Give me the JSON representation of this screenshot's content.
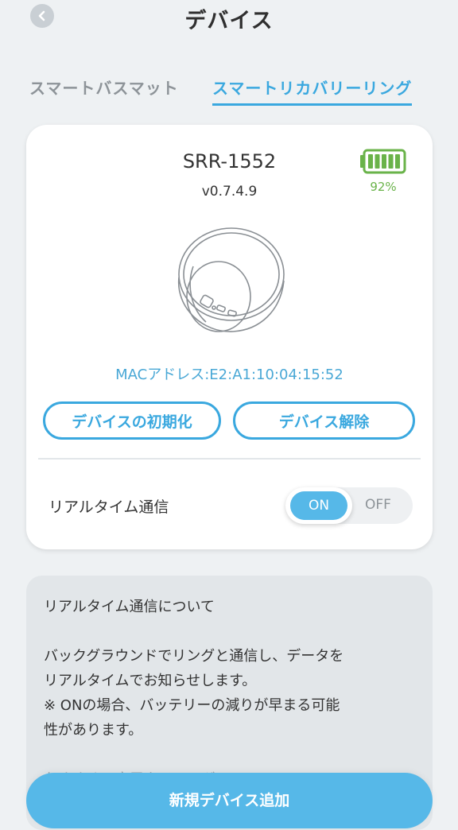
{
  "header": {
    "title": "デバイス"
  },
  "tabs": [
    {
      "label": "スマートバスマット",
      "active": false
    },
    {
      "label": "スマートリカバリーリング",
      "active": true
    }
  ],
  "device": {
    "name": "SRR-1552",
    "version": "v0.7.4.9",
    "battery_percent": "92%",
    "battery_level": 0.92,
    "mac": "MACアドレス:E2:A1:10:04:15:52",
    "init_button": "デバイスの初期化",
    "release_button": "デバイス解除",
    "realtime_label": "リアルタイム通信",
    "toggle_on": "ON",
    "toggle_off": "OFF",
    "toggle_state": "ON"
  },
  "info": {
    "title": "リアルタイム通信について",
    "line1": "バックグラウンドでリングと通信し、データを",
    "line2": "リアルタイムでお知らせします。",
    "line3": "※ ONの場合、バッテリーの減りが早まる可能",
    "line4": "性があります。",
    "line5": "おすすめの充電タイミング"
  },
  "footer": {
    "add_button": "新規デバイス追加"
  },
  "colors": {
    "accent": "#3aa8df",
    "battery": "#6ab34a",
    "button_fill": "#56b8e8"
  },
  "icons": {
    "back": "chevron-left-icon",
    "battery": "battery-icon",
    "ring": "ring-image"
  }
}
